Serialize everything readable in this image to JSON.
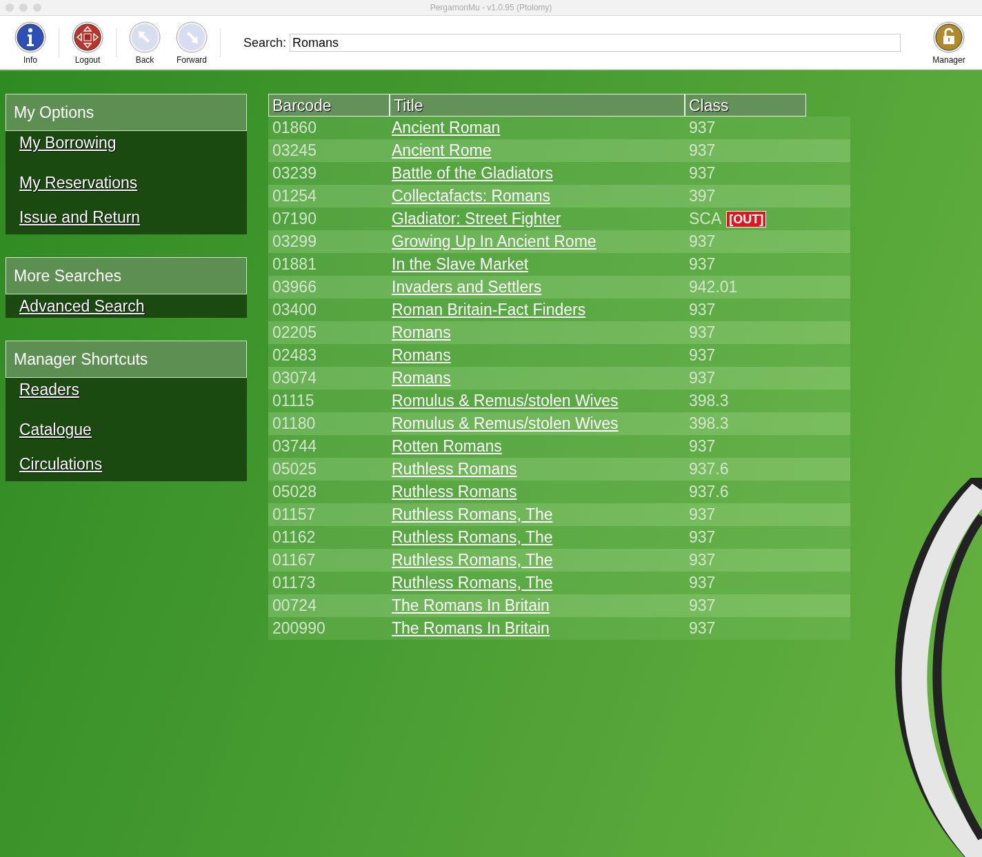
{
  "window": {
    "title": "PergamonMu - v1.0.95 (Ptolomy)"
  },
  "toolbar": {
    "buttons": [
      {
        "kind": "info",
        "label": "Info",
        "disabled": false
      },
      {
        "kind": "logout",
        "label": "Logout",
        "disabled": false
      },
      {
        "kind": "back",
        "label": "Back",
        "disabled": true
      },
      {
        "kind": "forward",
        "label": "Forward",
        "disabled": true
      }
    ],
    "search": {
      "label": "Search:",
      "value": "Romans"
    },
    "manager": {
      "label": "Manager"
    }
  },
  "sidebar": [
    {
      "title": "My Options",
      "links": [
        "My Borrowing",
        "My Reservations",
        "Issue and Return"
      ]
    },
    {
      "title": "More Searches",
      "links": [
        "Advanced Search"
      ]
    },
    {
      "title": "Manager Shortcuts",
      "links": [
        "Readers",
        "Catalogue",
        "Circulations"
      ]
    }
  ],
  "table": {
    "columns": [
      "Barcode",
      "Title",
      "Class"
    ],
    "rows": [
      {
        "barcode": "01860",
        "title": "Ancient Roman",
        "class": "937"
      },
      {
        "barcode": "03245",
        "title": "Ancient Rome",
        "class": "937"
      },
      {
        "barcode": "03239",
        "title": "Battle of the Gladiators",
        "class": "937"
      },
      {
        "barcode": "01254",
        "title": "Collectafacts: Romans",
        "class": "397"
      },
      {
        "barcode": "07190",
        "title": "Gladiator: Street Fighter",
        "class": "SCA",
        "status": "[OUT]"
      },
      {
        "barcode": "03299",
        "title": "Growing Up In Ancient Rome",
        "class": "937"
      },
      {
        "barcode": "01881",
        "title": "In the Slave Market",
        "class": "937"
      },
      {
        "barcode": "03966",
        "title": "Invaders and Settlers",
        "class": "942.01"
      },
      {
        "barcode": "03400",
        "title": "Roman Britain-Fact Finders",
        "class": "937"
      },
      {
        "barcode": "02205",
        "title": "Romans",
        "class": "937"
      },
      {
        "barcode": "02483",
        "title": "Romans",
        "class": "937"
      },
      {
        "barcode": "03074",
        "title": "Romans",
        "class": "937"
      },
      {
        "barcode": "01115",
        "title": "Romulus & Remus/stolen Wives",
        "class": "398.3"
      },
      {
        "barcode": "01180",
        "title": "Romulus & Remus/stolen Wives",
        "class": "398.3"
      },
      {
        "barcode": "03744",
        "title": "Rotten Romans",
        "class": "937"
      },
      {
        "barcode": "05025",
        "title": "Ruthless Romans",
        "class": "937.6"
      },
      {
        "barcode": "05028",
        "title": "Ruthless Romans",
        "class": "937.6"
      },
      {
        "barcode": "01157",
        "title": "Ruthless Romans, The",
        "class": "937"
      },
      {
        "barcode": "01162",
        "title": "Ruthless Romans, The",
        "class": "937"
      },
      {
        "barcode": "01167",
        "title": "Ruthless Romans, The",
        "class": "937"
      },
      {
        "barcode": "01173",
        "title": "Ruthless Romans, The",
        "class": "937"
      },
      {
        "barcode": "00724",
        "title": "The Romans In Britain",
        "class": "937"
      },
      {
        "barcode": "200990",
        "title": "The Romans In Britain",
        "class": "937"
      }
    ]
  }
}
